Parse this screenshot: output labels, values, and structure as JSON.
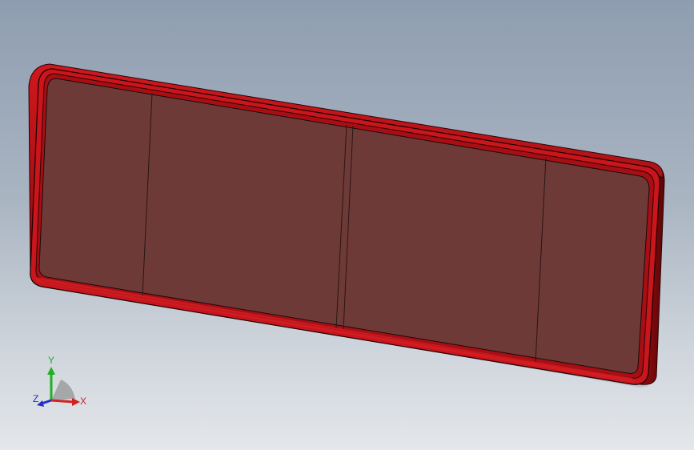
{
  "triad": {
    "x_label": "X",
    "y_label": "Y",
    "z_label": "Z",
    "x_color": "#d42020",
    "y_color": "#20b020",
    "z_color": "#2030c8"
  },
  "model": {
    "face_color": "#6e3a38",
    "rim_color": "#c4141a",
    "rim_dark_color": "#6a0a0c"
  }
}
